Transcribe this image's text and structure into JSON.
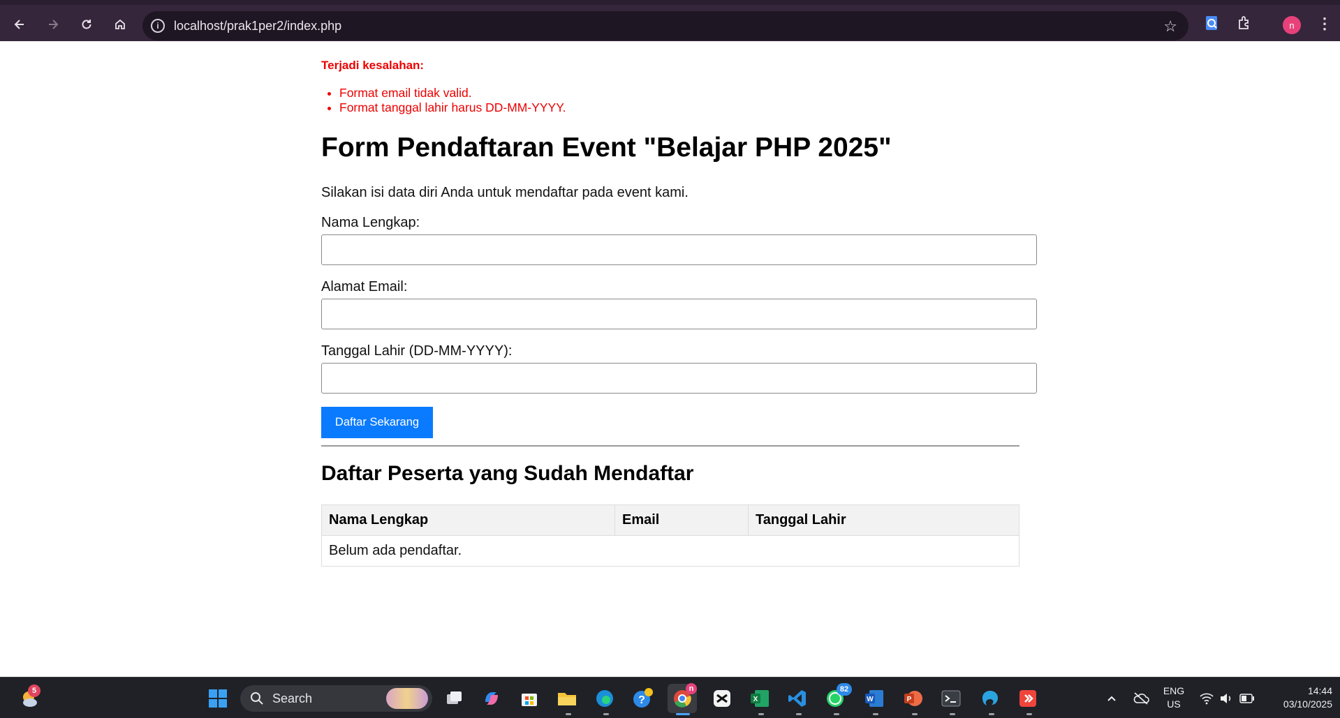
{
  "browser": {
    "url": "localhost/prak1per2/index.php",
    "profile_initial": "n"
  },
  "errors": {
    "title": "Terjadi kesalahan:",
    "items": [
      "Format email tidak valid.",
      "Format tanggal lahir harus DD-MM-YYYY."
    ]
  },
  "form": {
    "title": "Form Pendaftaran Event \"Belajar PHP 2025\"",
    "intro": "Silakan isi data diri Anda untuk mendaftar pada event kami.",
    "fields": {
      "name_label": "Nama Lengkap:",
      "name_value": "",
      "email_label": "Alamat Email:",
      "email_value": "",
      "dob_label": "Tanggal Lahir (DD-MM-YYYY):",
      "dob_value": ""
    },
    "submit_label": "Daftar Sekarang"
  },
  "participants": {
    "title": "Daftar Peserta yang Sudah Mendaftar",
    "columns": [
      "Nama Lengkap",
      "Email",
      "Tanggal Lahir"
    ],
    "empty_message": "Belum ada pendaftar."
  },
  "taskbar": {
    "search_label": "Search",
    "weather_badge": "5",
    "whatsapp_badge": "82",
    "chrome_badge": "n",
    "language_line1": "ENG",
    "language_line2": "US",
    "time": "14:44",
    "date": "03/10/2025"
  },
  "colors": {
    "error": "#ee0000",
    "button": "#0a7bff",
    "browser_chrome": "#35263b"
  }
}
